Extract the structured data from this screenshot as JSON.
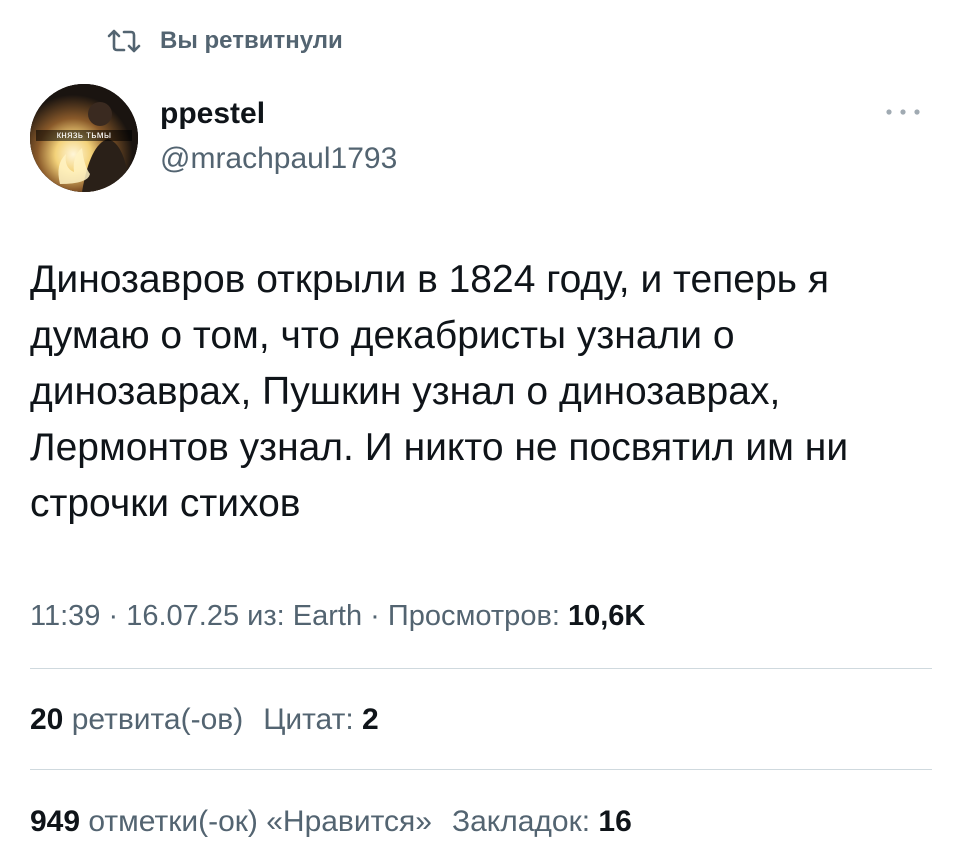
{
  "retweet_banner": {
    "icon": "retweet-icon",
    "label": "Вы ретвитнули"
  },
  "author": {
    "avatar_caption": "князь тьмы",
    "name": "ppestel",
    "handle": "@mrachpaul1793"
  },
  "menu": {
    "icon": "more-icon"
  },
  "tweet": {
    "text": "Динозавров открыли в 1824 году, и теперь я\nдумаю о том, что декабристы узнали о\nдинозаврах, Пушкин узнал о динозаврах,\nЛермонтов узнал. И никто не посвятил им ни\nстрочки стихов"
  },
  "meta": {
    "time": "11:39",
    "separator": " · ",
    "date": "16.07.25",
    "source_prefix": " из: ",
    "source": "Earth",
    "views_label": "Просмотров: ",
    "views_count": "10,6K"
  },
  "stats": {
    "retweets_count": "20",
    "retweets_label": " ретвита(-ов)",
    "quotes_label": "Цитат: ",
    "quotes_count": "2",
    "likes_count": "949",
    "likes_label": " отметки(-ок) «Нравится»",
    "bookmarks_label": "Закладок: ",
    "bookmarks_count": "16"
  },
  "colors": {
    "text_primary": "#0f1419",
    "text_secondary": "#536471",
    "divider": "#cfd9de",
    "background": "#ffffff"
  }
}
